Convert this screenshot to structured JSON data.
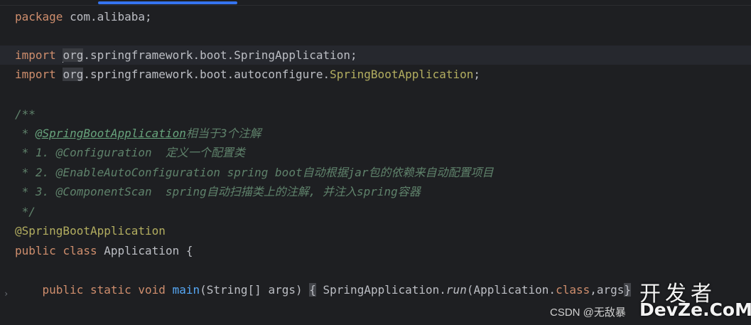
{
  "editor": {
    "line1": {
      "kw": "package",
      "rest": " com.alibaba;"
    },
    "line3": {
      "kw": "import",
      "pre": " ",
      "pkg": "org",
      "rest": ".springframework.boot.SpringApplication;"
    },
    "line4": {
      "kw": "import",
      "pre": " ",
      "pkg": "org",
      "mid": ".springframework.boot.autoconfigure.",
      "cls": "SpringBootApplication",
      "end": ";"
    },
    "line6": "/**",
    "line7": {
      "pre": " * ",
      "tag": "@SpringBootApplication",
      "rest": "相当于3个注解"
    },
    "line8": " * 1. @Configuration  定义一个配置类",
    "line9": " * 2. @EnableAutoConfiguration spring boot自动根据jar包的依赖来自动配置项目",
    "line10": " * 3. @ComponentScan  spring自动扫描类上的注解, 并注入spring容器",
    "line11": " */",
    "line12": "@SpringBootApplication",
    "line13": {
      "kw1": "public",
      "kw2": "class",
      "rest": " Application {"
    },
    "line15": {
      "indent": "    ",
      "kw1": "public",
      "kw2": "static",
      "kw3": "void",
      "fn": "main",
      "params": "(String[] args)",
      "lbrace": "{",
      "body1": " SpringApplication.",
      "call": "run",
      "body2": "(Application.",
      "kw4": "class",
      "body3": ",args",
      "rbrace": "}"
    }
  },
  "gutter": {
    "fold_icon": "chevron-right-icon",
    "fold_glyph": "›"
  },
  "watermark": {
    "text": "CSDN @无敌暴",
    "logo_cn": "开发者",
    "logo_en": "DevZe.CoM"
  },
  "colors": {
    "background": "#1e1f22",
    "keyword": "#cf8e6d",
    "annotation": "#b3ae60",
    "comment": "#5f826b",
    "function": "#56a8f5",
    "text": "#bcbec4",
    "accent": "#3574f0"
  }
}
